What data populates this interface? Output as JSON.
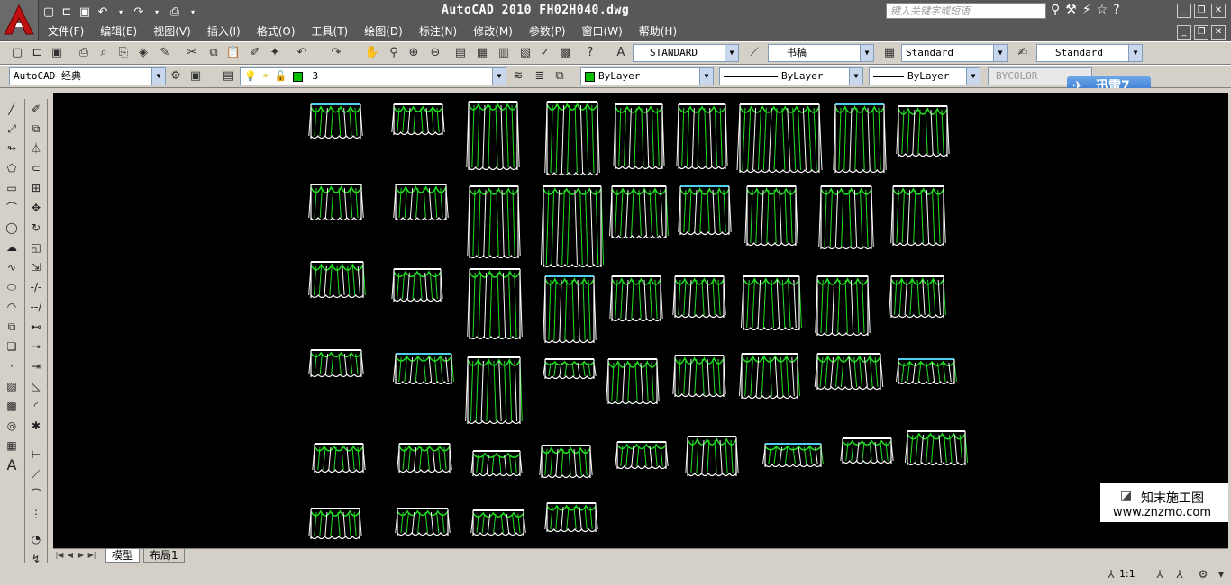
{
  "window": {
    "title": "AutoCAD 2010   FH02H040.dwg",
    "search_placeholder": "键入关键字或短语"
  },
  "menu": [
    "文件(F)",
    "编辑(E)",
    "视图(V)",
    "插入(I)",
    "格式(O)",
    "工具(T)",
    "绘图(D)",
    "标注(N)",
    "修改(M)",
    "参数(P)",
    "窗口(W)",
    "帮助(H)"
  ],
  "toolbar_styles": {
    "text_style": "STANDARD",
    "dim_style": "书稿",
    "table_style": "Standard",
    "mleader_style": "Standard"
  },
  "toolbar_layers": {
    "workspace": "AutoCAD 经典",
    "layer": "3",
    "color": "ByLayer",
    "linetype": "ByLayer",
    "lineweight": "ByLayer",
    "plotstyle": "BYCOLOR"
  },
  "xunlei": {
    "label": "迅雷7"
  },
  "layout_tabs": [
    "模型",
    "布局1"
  ],
  "status": {
    "scale": "1:1"
  },
  "watermark": {
    "name": "知末施工图",
    "url": "www.znzmo.com"
  },
  "colors": {
    "cad_bg": "#000000",
    "curtain_green": "#22e022",
    "curtain_white": "#ffffff",
    "curtain_cyan": "#4fd0f0"
  }
}
